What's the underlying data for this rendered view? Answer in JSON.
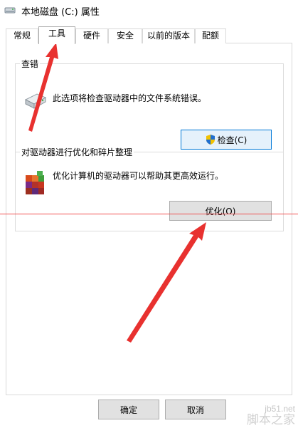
{
  "window": {
    "title": "本地磁盘 (C:) 属性",
    "icon": "drive-icon"
  },
  "tabs": [
    {
      "label": "常规",
      "active": false
    },
    {
      "label": "工具",
      "active": true
    },
    {
      "label": "硬件",
      "active": false
    },
    {
      "label": "安全",
      "active": false
    },
    {
      "label": "以前的版本",
      "active": false
    },
    {
      "label": "配额",
      "active": false
    }
  ],
  "error_check": {
    "title": "查错",
    "description": "此选项将检查驱动器中的文件系统错误。",
    "button_label": "检查(C)",
    "icon": "disk-drive-icon",
    "button_icon": "uac-shield-icon"
  },
  "optimize": {
    "title": "对驱动器进行优化和碎片整理",
    "description": "优化计算机的驱动器可以帮助其更高效运行。",
    "button_label": "优化(O)",
    "icon": "defrag-icon"
  },
  "footer": {
    "ok_label": "确定",
    "cancel_label": "取消"
  },
  "watermark": {
    "site": "jb51.net",
    "name": "脚本之家"
  },
  "colors": {
    "annotation_red": "#e8312f",
    "focus_blue": "#0078d7",
    "button_gray": "#e1e1e1"
  }
}
